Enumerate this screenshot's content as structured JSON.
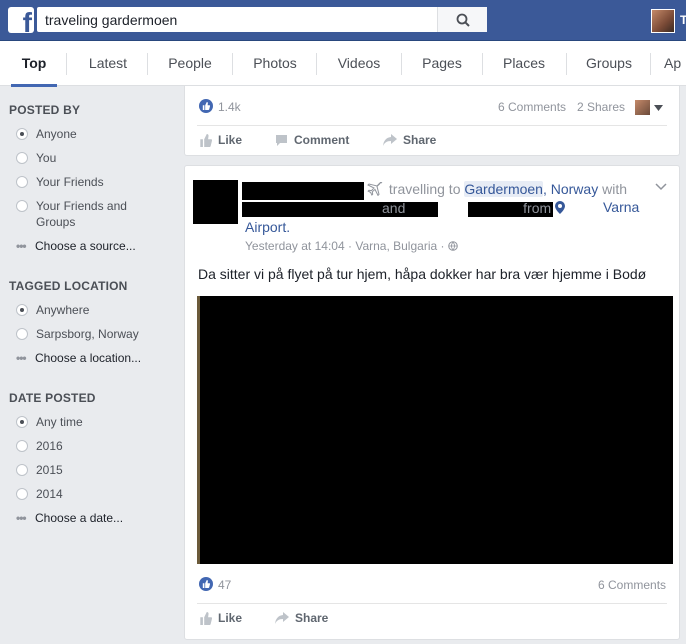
{
  "header": {
    "logo": "f",
    "search_value": "traveling gardermoen",
    "search_icon": "search-icon",
    "user_initial": "T"
  },
  "tabs": [
    "Top",
    "Latest",
    "People",
    "Photos",
    "Videos",
    "Pages",
    "Places",
    "Groups",
    "Ap"
  ],
  "sidebar": {
    "posted_by": {
      "heading": "POSTED BY",
      "options": [
        "Anyone",
        "You",
        "Your Friends",
        "Your Friends and Groups"
      ],
      "selected": 0,
      "choose": "Choose a source..."
    },
    "tagged_location": {
      "heading": "TAGGED LOCATION",
      "options": [
        "Anywhere",
        "Sarpsborg, Norway"
      ],
      "selected": 0,
      "choose": "Choose a location..."
    },
    "date_posted": {
      "heading": "DATE POSTED",
      "options": [
        "Any time",
        "2016",
        "2015",
        "2014"
      ],
      "selected": 0,
      "choose": "Choose a date..."
    }
  },
  "post1": {
    "likes": "1.4k",
    "comments": "6 Comments",
    "shares": "2 Shares",
    "actions": {
      "like": "Like",
      "comment": "Comment",
      "share": "Share"
    }
  },
  "post2": {
    "activity": "travelling to",
    "place": "Gardermoen",
    "place_rest": ", Norway",
    "with": "with",
    "and": "and",
    "from": "from",
    "origin": "Varna Airport.",
    "timestamp": "Yesterday at 14:04",
    "location": "Varna, Bulgaria",
    "text": "Da sitter vi på flyet på tur hjem, håpa dokker har bra vær hjemme i Bodø",
    "likes": "47",
    "comments": "6 Comments",
    "actions": {
      "like": "Like",
      "share": "Share"
    }
  },
  "colors": {
    "brand": "#3b5998",
    "link": "#365899",
    "like_blue": "#4267b2"
  }
}
